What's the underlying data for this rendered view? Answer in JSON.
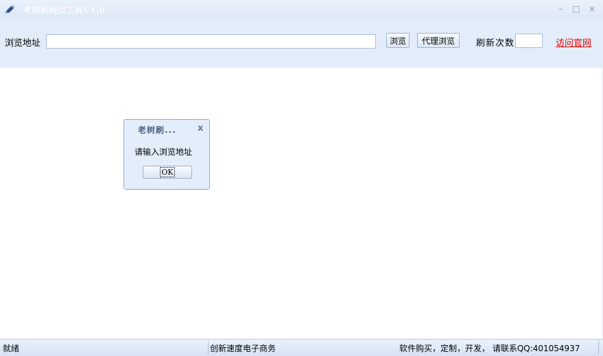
{
  "window": {
    "title": "老树刷网页工具V1.0",
    "controls": {
      "minimize": "–",
      "maximize": "□",
      "close": "×"
    }
  },
  "toolbar": {
    "url_label": "浏览地址",
    "url_value": "",
    "browse_label": "浏览",
    "proxy_label": "代理浏览",
    "refresh_label": "刷新次数",
    "refresh_value": "",
    "site_link": "访问官网"
  },
  "dialog": {
    "title": "老树刷...",
    "close": "x",
    "message": "请输入浏览地址",
    "ok_label": "OK"
  },
  "status": {
    "ready": "就绪",
    "company": "创新速度电子商务",
    "contact": "软件购买，定制，开发， 请联系QQ:401054937"
  },
  "colors": {
    "toolbar_bg": "#e3edfa",
    "link": "#e00000",
    "dialog_bg": "#e4eefb"
  },
  "icons": [
    "app-icon",
    "minimize-icon",
    "maximize-icon",
    "close-icon",
    "dialog-close-icon"
  ]
}
